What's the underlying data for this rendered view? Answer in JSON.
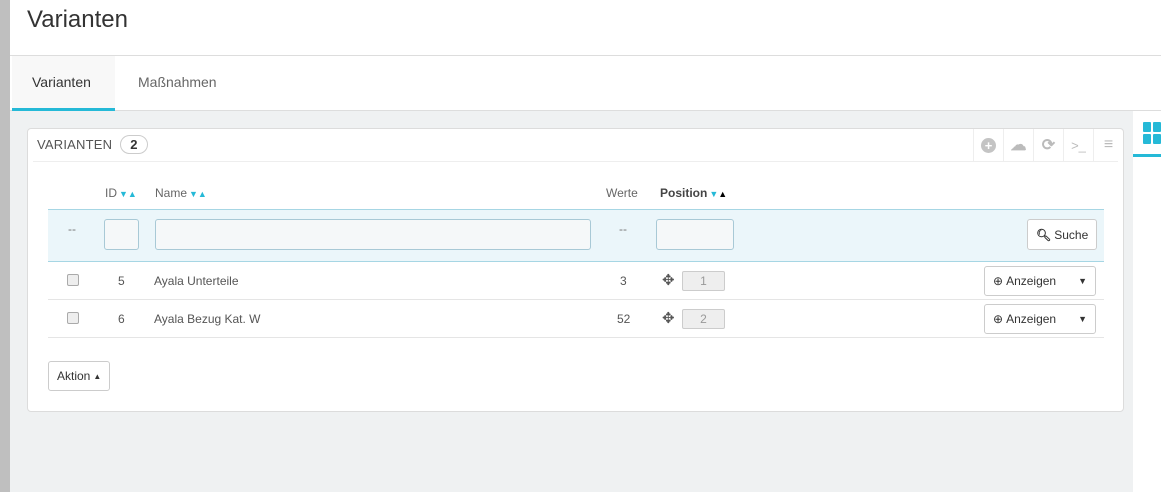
{
  "page_title": "Varianten",
  "tabs": [
    {
      "label": "Varianten",
      "active": true
    },
    {
      "label": "Maßnahmen",
      "active": false
    }
  ],
  "panel": {
    "title": "VARIANTEN",
    "count": "2",
    "toolbar": [
      "add-icon",
      "cloud-upload-icon",
      "refresh-icon",
      "terminal-icon",
      "database-icon"
    ]
  },
  "columns": {
    "id": "ID",
    "name": "Name",
    "werte": "Werte",
    "position": "Position"
  },
  "filter": {
    "placeholder_dash": "--",
    "werte_dash": "--",
    "search_label": "Suche"
  },
  "rows": [
    {
      "id": "5",
      "name": "Ayala Unterteile",
      "werte": "3",
      "position": "1",
      "action": "Anzeigen"
    },
    {
      "id": "6",
      "name": "Ayala Bezug Kat. W",
      "werte": "52",
      "position": "2",
      "action": "Anzeigen"
    }
  ],
  "bulk_action": "Aktion",
  "accent": "#25b9d7"
}
